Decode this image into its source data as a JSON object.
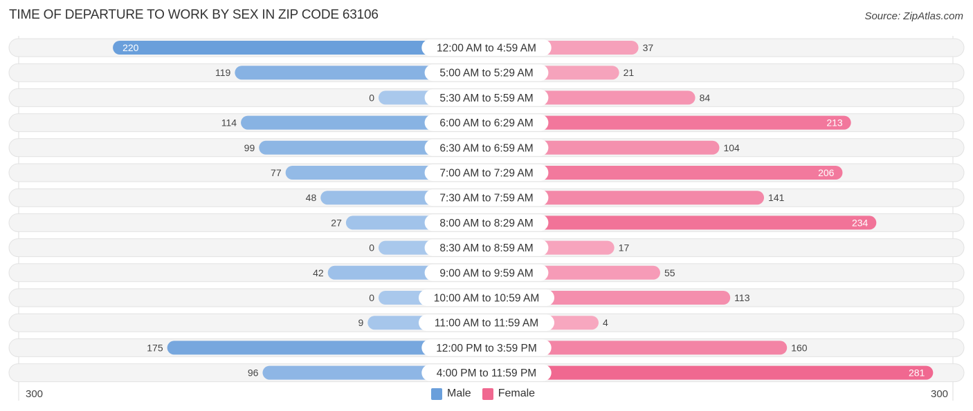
{
  "header": {
    "title": "TIME OF DEPARTURE TO WORK BY SEX IN ZIP CODE 63106",
    "source": "Source: ZipAtlas.com"
  },
  "colors": {
    "male": "#6a9fdb",
    "male_light": "#a9c8ec",
    "female": "#f06890",
    "female_light": "#f7a8c0",
    "track": "#f4f4f4"
  },
  "chart_data": {
    "type": "bar",
    "orientation": "horizontal-diverging",
    "title": "TIME OF DEPARTURE TO WORK BY SEX IN ZIP CODE 63106",
    "categories": [
      "12:00 AM to 4:59 AM",
      "5:00 AM to 5:29 AM",
      "5:30 AM to 5:59 AM",
      "6:00 AM to 6:29 AM",
      "6:30 AM to 6:59 AM",
      "7:00 AM to 7:29 AM",
      "7:30 AM to 7:59 AM",
      "8:00 AM to 8:29 AM",
      "8:30 AM to 8:59 AM",
      "9:00 AM to 9:59 AM",
      "10:00 AM to 10:59 AM",
      "11:00 AM to 11:59 AM",
      "12:00 PM to 3:59 PM",
      "4:00 PM to 11:59 PM"
    ],
    "series": [
      {
        "name": "Male",
        "values": [
          220,
          119,
          0,
          114,
          99,
          77,
          48,
          27,
          0,
          42,
          0,
          9,
          175,
          96
        ]
      },
      {
        "name": "Female",
        "values": [
          37,
          21,
          84,
          213,
          104,
          206,
          141,
          234,
          17,
          55,
          113,
          4,
          160,
          281
        ]
      }
    ],
    "xlim": [
      300,
      300
    ],
    "axis_labels": {
      "left": "300",
      "right": "300"
    },
    "legend": {
      "position": "bottom-center",
      "entries": [
        "Male",
        "Female"
      ]
    }
  }
}
